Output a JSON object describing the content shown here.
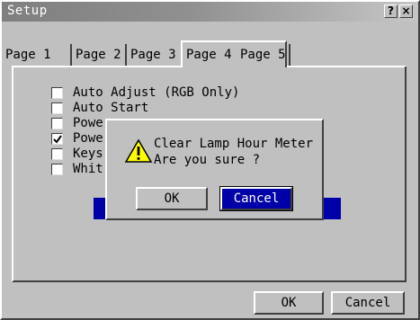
{
  "window": {
    "title": "Setup",
    "help_glyph": "?",
    "close_glyph": "×"
  },
  "tabs": [
    {
      "label": "Page 1",
      "active": false
    },
    {
      "label": "Page 2",
      "active": false
    },
    {
      "label": "Page 3",
      "active": false
    },
    {
      "label": "Page 4",
      "active": true
    },
    {
      "label": "Page 5",
      "active": false
    }
  ],
  "options": [
    {
      "label": "Auto Adjust (RGB Only)",
      "checked": false
    },
    {
      "label": "Auto Start",
      "checked": false
    },
    {
      "label": "Powe",
      "checked": false
    },
    {
      "label": "Powe",
      "checked": true
    },
    {
      "label": "Keys",
      "checked": false
    },
    {
      "label": "Whit",
      "checked": false
    }
  ],
  "dialog": {
    "line1": "Clear Lamp Hour Meter",
    "line2": "Are you sure ?",
    "ok_label": "OK",
    "cancel_label": "Cancel",
    "icon": "warning-icon"
  },
  "footer": {
    "ok_label": "OK",
    "cancel_label": "Cancel"
  },
  "colors": {
    "face": "#c0c0c0",
    "selection": "#0000a8",
    "warning": "#ffff00"
  }
}
